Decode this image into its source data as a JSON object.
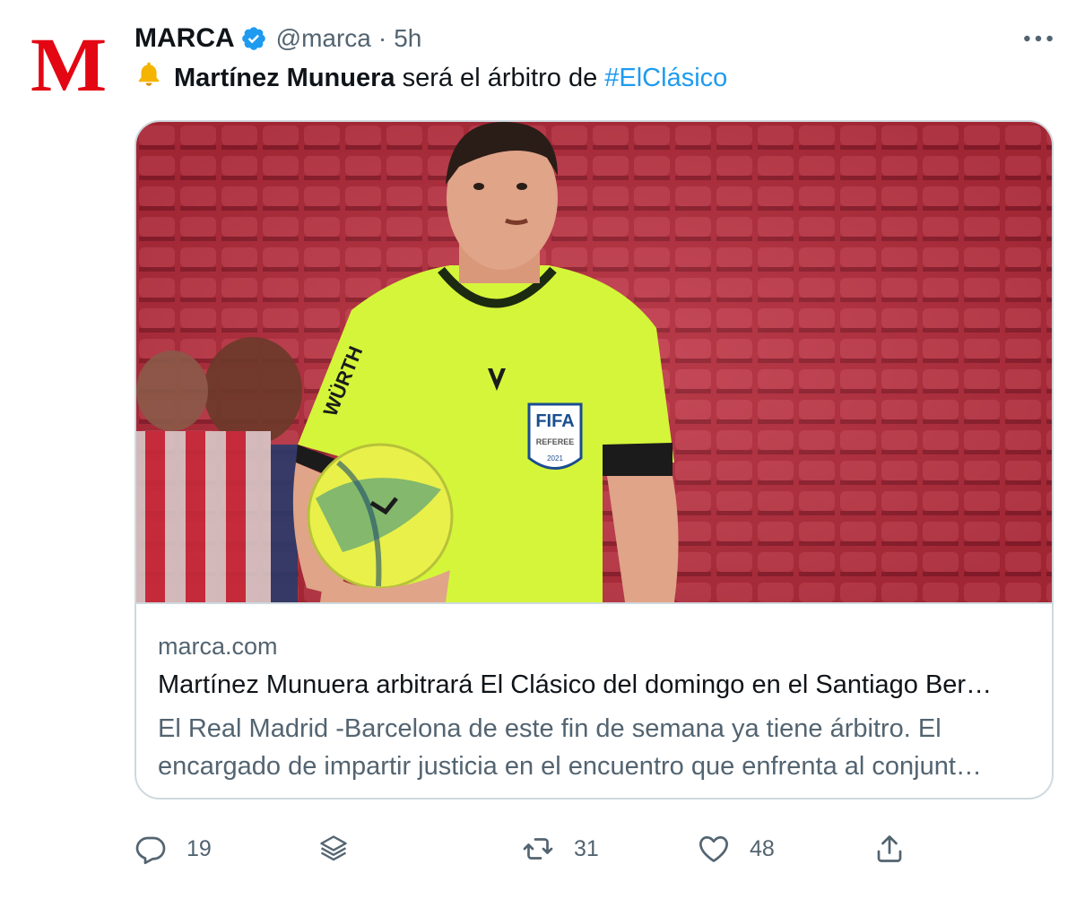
{
  "account": {
    "display_name": "MARCA",
    "handle": "@marca",
    "separator": "·",
    "time": "5h",
    "avatar_letter": "M",
    "avatar_color": "#e30613",
    "verified_color": "#1d9bf0"
  },
  "tweet": {
    "bell_icon": "bell-icon",
    "bold_text": "Martínez Munuera",
    "text": " será el árbitro de ",
    "hashtag": "#ElClásico"
  },
  "card": {
    "domain": "marca.com",
    "title": "Martínez Munuera arbitrará El Clásico del domingo en el Santiago Ber…",
    "description": "El Real Madrid -Barcelona de este fin de semana ya tiene árbitro. El encargado de impartir justicia en el encuentro que enfrenta al conjunt…",
    "image": {
      "jersey_sponsor": "WÜRTH",
      "badge_top": "FIFA",
      "badge_bottom": "REFEREE",
      "badge_year": "2021"
    }
  },
  "actions": {
    "reply_count": "19",
    "retweet_count": "31",
    "like_count": "48"
  }
}
